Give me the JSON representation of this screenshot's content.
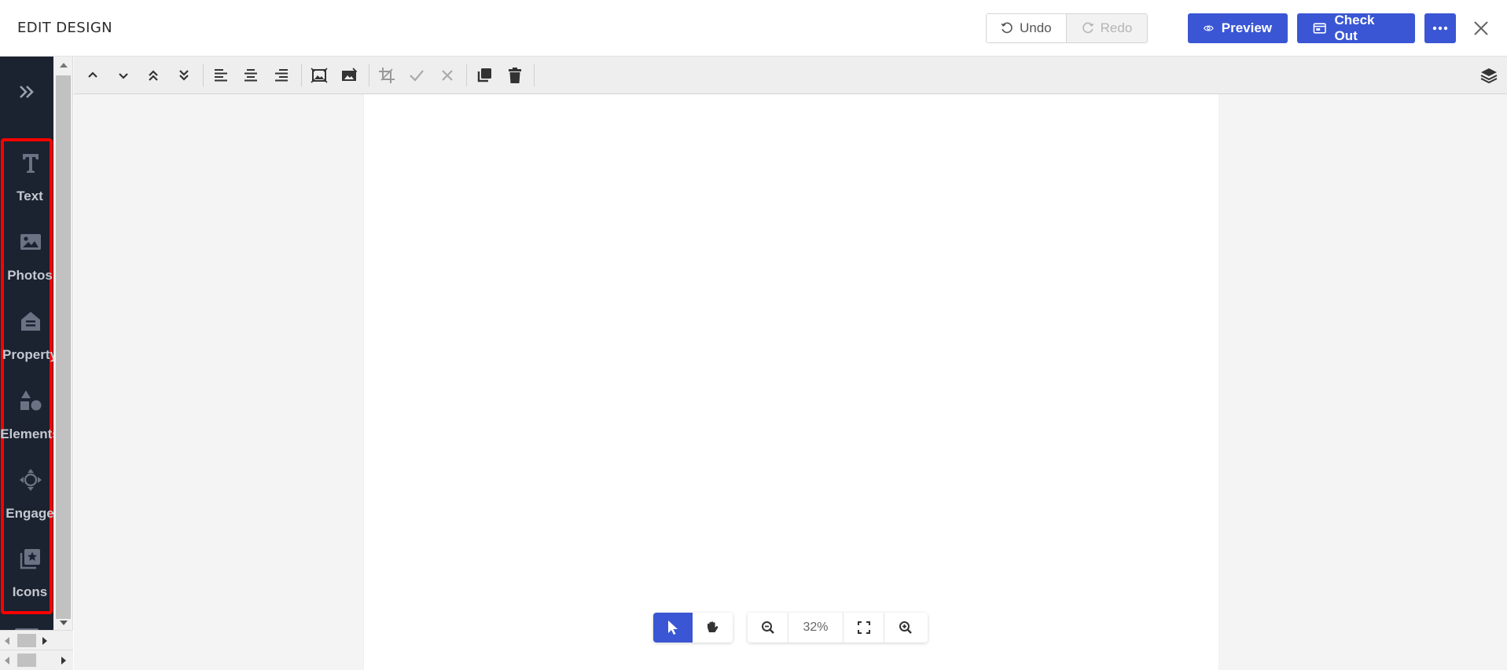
{
  "header": {
    "title": "EDIT DESIGN",
    "undo_label": "Undo",
    "redo_label": "Redo",
    "preview_label": "Preview",
    "checkout_label": "Check Out"
  },
  "sidebar": {
    "items": [
      {
        "label": "Text",
        "icon": "text-icon"
      },
      {
        "label": "Photos",
        "icon": "image-icon"
      },
      {
        "label": "Property",
        "icon": "house-icon"
      },
      {
        "label": "Elements",
        "icon": "shapes-icon"
      },
      {
        "label": "Engage",
        "icon": "move-icon"
      },
      {
        "label": "Icons",
        "icon": "star-library-icon"
      }
    ]
  },
  "zoom": {
    "level": "32%"
  },
  "colors": {
    "primary": "#3a56d4",
    "sidebar_bg": "#1b2230",
    "highlight": "#ff0000"
  }
}
